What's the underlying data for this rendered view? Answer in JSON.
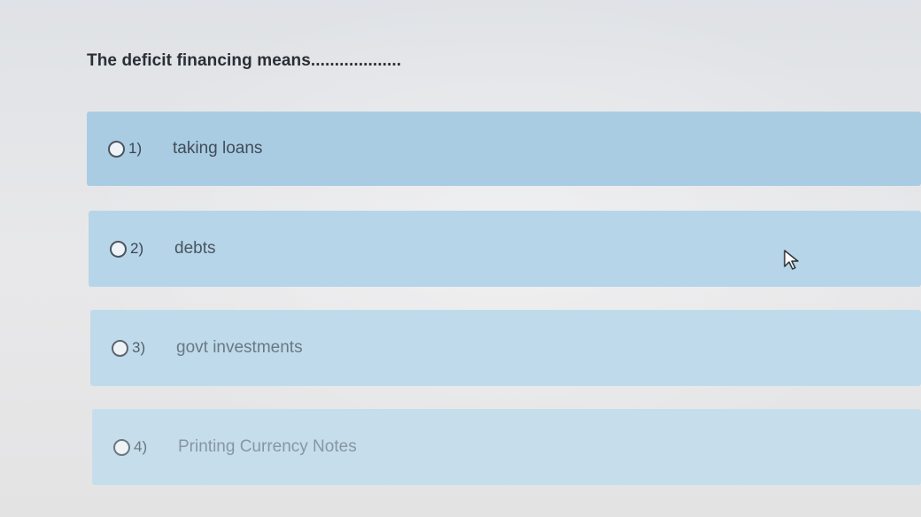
{
  "question": {
    "text": "The deficit financing means..................."
  },
  "options": [
    {
      "number": "1)",
      "label": "taking loans"
    },
    {
      "number": "2)",
      "label": "debts"
    },
    {
      "number": "3)",
      "label": "govt investments"
    },
    {
      "number": "4)",
      "label": "Printing Currency Notes"
    }
  ],
  "colors": {
    "option_bg": "#a9cce3",
    "question_text": "#2a2f36",
    "page_bg": "#e6e7ea"
  },
  "icons": {
    "cursor": "mouse-pointer-icon",
    "radio": "radio-button"
  }
}
